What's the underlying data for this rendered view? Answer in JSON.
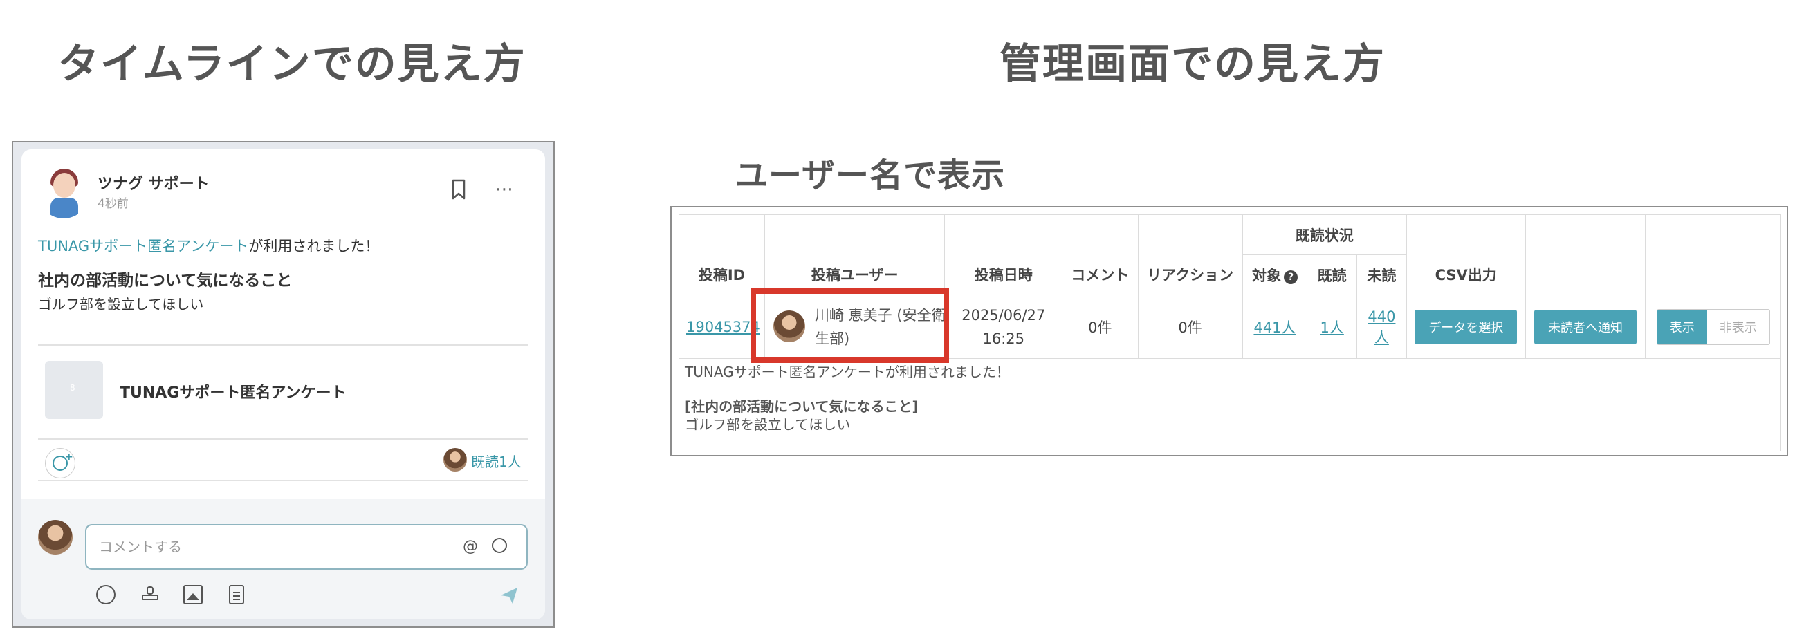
{
  "headings": {
    "timeline": "タイムラインでの見え方",
    "admin": "管理画面での見え方",
    "admin_sub": "ユーザー名で表示"
  },
  "timeline": {
    "author": "ツナグ サポート",
    "time": "4秒前",
    "announce_link": "TUNAGサポート匿名アンケート",
    "announce_suffix": "が利用されました！",
    "title": "社内の部活動について気になること",
    "body": "ゴルフ部を設立してほしい",
    "survey_name": "TUNAGサポート匿名アンケート",
    "survey_thumb_mark": "8",
    "read_count": "既読1人",
    "comment_placeholder": "コメントする",
    "at_symbol": "@"
  },
  "admin_table": {
    "headers": {
      "post_id": "投稿ID",
      "post_user": "投稿ユーザー",
      "post_date": "投稿日時",
      "comment": "コメント",
      "reaction": "リアクション",
      "read_status": "既読状況",
      "target": "対象",
      "read": "既読",
      "unread": "未読",
      "csv": "CSV出力"
    },
    "row": {
      "post_id": "19045374",
      "user_name": "川崎 恵美子 (安全衛生部)",
      "date_line1": "2025/06/27",
      "date_line2": "16:25",
      "comments": "0件",
      "reactions": "0件",
      "target": "441人",
      "read": "1人",
      "unread_line1": "440",
      "unread_line2": "人",
      "select_data_btn": "データを選択",
      "notify_unread_btn": "未読者へ通知",
      "show_btn": "表示",
      "hide_btn": "非表示"
    },
    "note": {
      "line1": "TUNAGサポート匿名アンケートが利用されました！",
      "line2": "[社内の部活動について気になること]",
      "line3": "ゴルフ部を設立してほしい"
    }
  },
  "colors": {
    "accent": "#4aa3b6",
    "link": "#3a97a8",
    "highlight": "#d8382b"
  }
}
